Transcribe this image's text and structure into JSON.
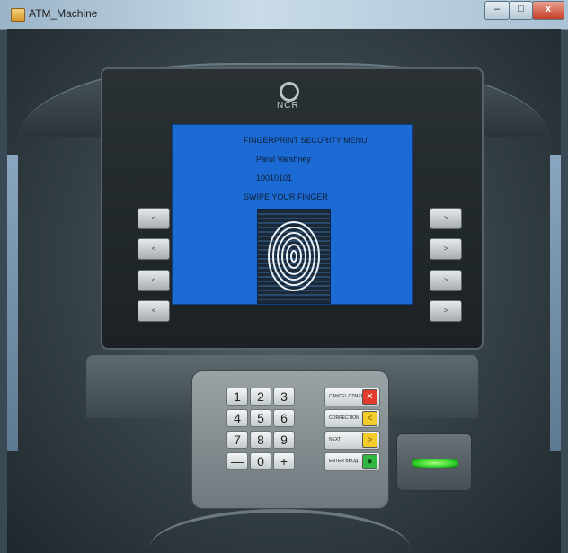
{
  "window": {
    "title": "ATM_Machine",
    "controls": {
      "minimize": "–",
      "maximize": "□",
      "close": "x"
    }
  },
  "brand": {
    "name": "NCR"
  },
  "side_buttons": {
    "left": [
      "<",
      "<",
      "<",
      "<"
    ],
    "right": [
      ">",
      ">",
      ">",
      ">"
    ]
  },
  "screen": {
    "menu_title": "FINGERPRINT SECURITY MENU",
    "user_name": "Parul Varshney",
    "account_id": "10010101",
    "instruction": "SWIPE YOUR FINGER"
  },
  "keypad": {
    "keys": [
      "1",
      "2",
      "3",
      "4",
      "5",
      "6",
      "7",
      "8",
      "9",
      "—",
      "0",
      "+"
    ],
    "function_keys": {
      "cancel": {
        "label": "CANCEL OTMEHA",
        "icon": "✕",
        "color": "#e23b2e"
      },
      "correction": {
        "label": "CORRECTION",
        "icon": "<",
        "color": "#f2cc2a"
      },
      "next": {
        "label": "NEXT",
        "icon": ">",
        "color": "#f2cc2a"
      },
      "enter": {
        "label": "ENTER BBOД",
        "icon": "●",
        "color": "#31b842"
      }
    }
  },
  "card_reader": {
    "status_light": "#3fe04a"
  }
}
